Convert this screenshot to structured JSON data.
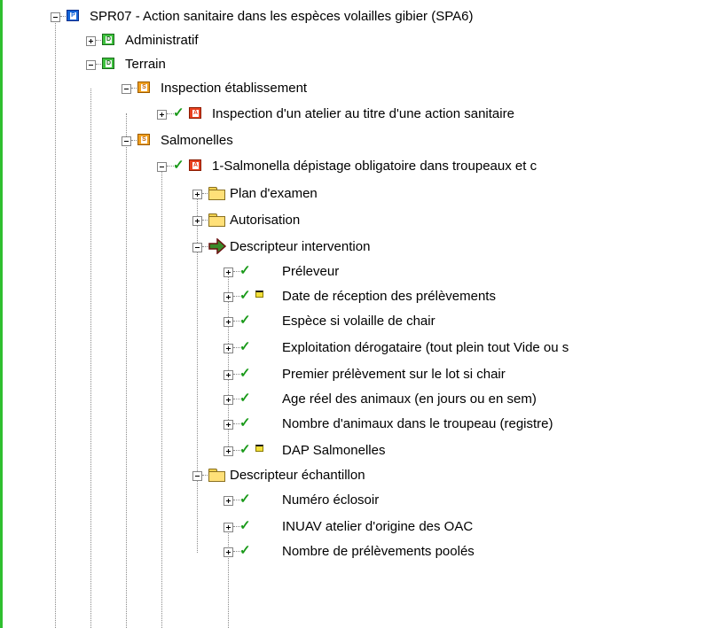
{
  "tree": {
    "items": [
      {
        "label": "SPR07 - Action sanitaire dans les espèces volailles gibier (SPA6)",
        "icon": "P",
        "expander": "minus",
        "check": false,
        "flag": false
      },
      {
        "label": "Administratif",
        "icon": "D",
        "expander": "plus",
        "check": false,
        "flag": false
      },
      {
        "label": "Terrain",
        "icon": "D",
        "expander": "minus",
        "check": false,
        "flag": false
      },
      {
        "label": "Inspection établissement",
        "icon": "S",
        "expander": "minus",
        "check": false,
        "flag": false
      },
      {
        "label": "Inspection d'un atelier au titre d'une action sanitaire",
        "icon": "A",
        "expander": "plus",
        "check": true,
        "flag": false
      },
      {
        "label": "Salmonelles",
        "icon": "S",
        "expander": "minus",
        "check": false,
        "flag": false
      },
      {
        "label": "1-Salmonella  dépistage obligatoire  dans troupeaux et c",
        "icon": "A",
        "expander": "minus",
        "check": true,
        "flag": false
      },
      {
        "label": "Plan d'examen",
        "icon": "folder",
        "expander": "plus",
        "check": false,
        "flag": false
      },
      {
        "label": "Autorisation",
        "icon": "folder",
        "expander": "plus",
        "check": false,
        "flag": false
      },
      {
        "label": "Descripteur intervention",
        "icon": "arrow",
        "expander": "minus",
        "check": false,
        "flag": false
      },
      {
        "label": "Préleveur",
        "icon": "none",
        "expander": "plus",
        "check": true,
        "flag": false
      },
      {
        "label": "Date de réception des prélèvements",
        "icon": "none",
        "expander": "plus",
        "check": true,
        "flag": true
      },
      {
        "label": "Espèce si volaille de chair",
        "icon": "none",
        "expander": "plus",
        "check": true,
        "flag": false
      },
      {
        "label": "Exploitation dérogataire (tout plein tout Vide ou s",
        "icon": "none",
        "expander": "plus",
        "check": true,
        "flag": false
      },
      {
        "label": "Premier prélèvement sur le lot si chair",
        "icon": "none",
        "expander": "plus",
        "check": true,
        "flag": false
      },
      {
        "label": "Age réel des animaux (en jours ou en sem)",
        "icon": "none",
        "expander": "plus",
        "check": true,
        "flag": false
      },
      {
        "label": "Nombre d'animaux dans le troupeau (registre)",
        "icon": "none",
        "expander": "plus",
        "check": true,
        "flag": false
      },
      {
        "label": "DAP Salmonelles",
        "icon": "none",
        "expander": "plus",
        "check": true,
        "flag": true
      },
      {
        "label": "Descripteur échantillon",
        "icon": "folder",
        "expander": "minus",
        "check": false,
        "flag": false
      },
      {
        "label": "Numéro  éclosoir",
        "icon": "none",
        "expander": "plus",
        "check": true,
        "flag": false
      },
      {
        "label": "INUAV atelier d'origine des OAC",
        "icon": "none",
        "expander": "plus",
        "check": true,
        "flag": false
      },
      {
        "label": "Nombre de prélèvements poolés",
        "icon": "none",
        "expander": "plus",
        "check": true,
        "flag": false
      }
    ]
  },
  "colors": {
    "check": "#1a9a1a",
    "leftbar": "#2fbf2f",
    "treeLine": "#8a8a8a"
  },
  "icons": {
    "P": "plan-icon",
    "D": "domain-icon",
    "S": "section-icon",
    "A": "action-icon",
    "folder": "folder-icon",
    "arrow": "arrow-icon",
    "check": "check-icon",
    "flag": "flag-icon"
  }
}
